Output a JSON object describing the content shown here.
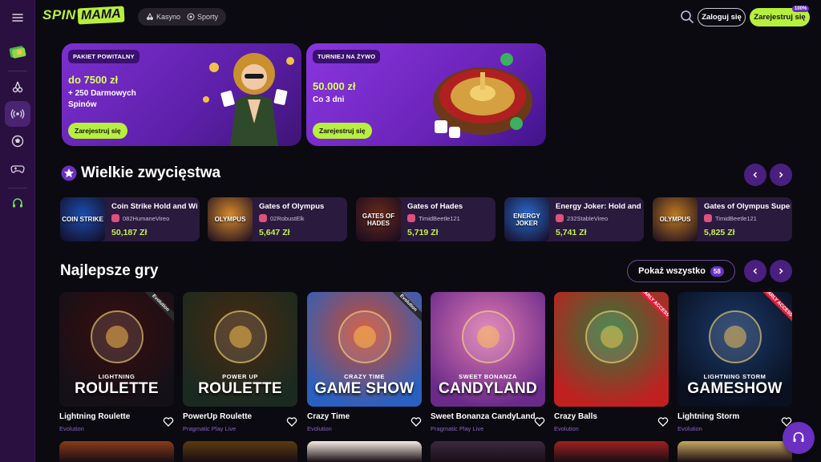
{
  "brand": {
    "part1": "SPIN",
    "part2": "MAMA"
  },
  "modes": [
    {
      "label": "Kasyno"
    },
    {
      "label": "Sporty"
    }
  ],
  "header": {
    "login_label": "Zaloguj się",
    "register_label": "Zarejestruj się",
    "register_badge": "100%"
  },
  "banners": [
    {
      "tag": "PAKIET POWITALNY",
      "amount": "do 7500 zł",
      "sub_lines": [
        "+ 250 Darmowych",
        "Spinów"
      ],
      "cta": "Zarejestruj się"
    },
    {
      "tag": "TURNIEJ NA ŻYWO",
      "amount": "50.000 zł",
      "sub_lines": [
        "Co 3 dni"
      ],
      "cta": "Zarejestruj się"
    }
  ],
  "wins_section": {
    "title": "Wielkie zwycięstwa"
  },
  "wins": [
    {
      "game": "Coin Strike Hold and Win",
      "user": "082HumaneVireo",
      "amount": "50,187 Zł",
      "thumb_text": "COIN STRIKE",
      "thumb_color": "#1a4fb0"
    },
    {
      "game": "Gates of Olympus",
      "user": "02RobustElk",
      "amount": "5,647 Zł",
      "thumb_text": "OLYMPUS",
      "thumb_color": "#d88a2a"
    },
    {
      "game": "Gates of Hades",
      "user": "TimidBeetle121",
      "amount": "5,719 Zł",
      "thumb_text": "GATES OF HADES",
      "thumb_color": "#6a2a1a"
    },
    {
      "game": "Energy Joker: Hold and Win",
      "user": "232StableVireo",
      "amount": "5,741 Zł",
      "thumb_text": "ENERGY JOKER",
      "thumb_color": "#2a6ad0"
    },
    {
      "game": "Gates of Olympus Super Scatter",
      "user": "TimidBeetle121",
      "amount": "5,825 Zł",
      "thumb_text": "OLYMPUS",
      "thumb_color": "#c07a20"
    }
  ],
  "games_section": {
    "title": "Najlepsze gry",
    "show_all": "Pokaż wszystko",
    "count": "58"
  },
  "games": [
    {
      "name": "Lightning Roulette",
      "provider": "Evolution",
      "label_top": "LIGHTNING",
      "label_main": "ROULETTE",
      "badge": "Evolution",
      "bg1": "#3a0e0e",
      "bg2": "#141018"
    },
    {
      "name": "PowerUp Roulette",
      "provider": "Pragmatic Play Live",
      "label_top": "POWER UP",
      "label_main": "ROULETTE",
      "badge": "",
      "bg1": "#4a2a10",
      "bg2": "#1a2a20"
    },
    {
      "name": "Crazy Time",
      "provider": "Evolution",
      "label_top": "CRAZY TIME",
      "label_main": "GAME SHOW",
      "badge": "Evolution",
      "bg1": "#d04a2a",
      "bg2": "#2a60c0"
    },
    {
      "name": "Sweet Bonanza CandyLand",
      "provider": "Pragmatic Play Live",
      "label_top": "SWEET BONANZA",
      "label_main": "CANDYLAND",
      "badge": "",
      "bg1": "#e07ab0",
      "bg2": "#6a2a8a"
    },
    {
      "name": "Crazy Balls",
      "provider": "Evolution",
      "label_top": "",
      "label_main": "",
      "badge": "EARLY ACCESS",
      "bg1": "#2a7a3a",
      "bg2": "#c02020"
    },
    {
      "name": "Lightning Storm",
      "provider": "Evolution",
      "label_top": "LIGHTNING STORM",
      "label_main": "GAMESHOW",
      "badge": "EARLY ACCESS",
      "bg1": "#1a3a6a",
      "bg2": "#0a1020"
    }
  ],
  "bottom_row_colors": [
    "#8a3a1a",
    "#5a3a10",
    "#f4ede4",
    "#3a2a40",
    "#a02020",
    "#c8a860"
  ],
  "colors": {
    "accent": "#b6f03c",
    "purple": "#6b2fc2",
    "bg": "#0b0a10"
  }
}
